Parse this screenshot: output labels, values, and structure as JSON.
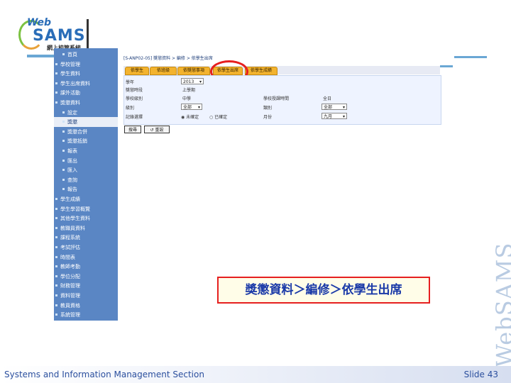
{
  "logo": {
    "web": "Web",
    "sams": "SAMS",
    "subtitle": "網上校管系統"
  },
  "sidebar": {
    "items": [
      {
        "label": "首頁",
        "level": "sub"
      },
      {
        "label": "學校管理",
        "level": "top"
      },
      {
        "label": "學生資料",
        "level": "top"
      },
      {
        "label": "學生出席資料",
        "level": "top"
      },
      {
        "label": "課外活動",
        "level": "top"
      },
      {
        "label": "獎懲資料",
        "level": "top"
      },
      {
        "label": "設定",
        "level": "sub"
      },
      {
        "label": "獎懲",
        "level": "sub",
        "active": true
      },
      {
        "label": "獎懲合併",
        "level": "sub"
      },
      {
        "label": "獎懲抵銷",
        "level": "sub"
      },
      {
        "label": "報表",
        "level": "sub"
      },
      {
        "label": "匯出",
        "level": "sub"
      },
      {
        "label": "匯入",
        "level": "sub"
      },
      {
        "label": "查詢",
        "level": "sub"
      },
      {
        "label": "報告",
        "level": "sub"
      },
      {
        "label": "學生成績",
        "level": "top"
      },
      {
        "label": "學生學習概覽",
        "level": "top"
      },
      {
        "label": "其他學生資料",
        "level": "top"
      },
      {
        "label": "教職員資料",
        "level": "top"
      },
      {
        "label": "課程系統",
        "level": "top"
      },
      {
        "label": "考試評估",
        "level": "top"
      },
      {
        "label": "時間表",
        "level": "top"
      },
      {
        "label": "教師考勤",
        "level": "top"
      },
      {
        "label": "學位分配",
        "level": "top"
      },
      {
        "label": "財務管理",
        "level": "top"
      },
      {
        "label": "資料管理",
        "level": "top"
      },
      {
        "label": "教員資格",
        "level": "top"
      },
      {
        "label": "系統管理",
        "level": "top"
      }
    ]
  },
  "breadcrumb": "[S-ANP02-05] 獎懲資料 > 編修 > 依學生出席",
  "tabs": [
    {
      "label": "依學生"
    },
    {
      "label": "依班級"
    },
    {
      "label": "依獎懲事項"
    },
    {
      "label": "依學生出席"
    },
    {
      "label": "依學生成績"
    }
  ],
  "form": {
    "year_label": "學年",
    "year_value": "2013",
    "period_label": "獎懲時段",
    "period_value": "上學期",
    "level_label": "學校級別",
    "level_value": "中學",
    "session_label": "學校授課時間",
    "session_value": "全日",
    "class_label": "級別",
    "class_value": "全部",
    "category_label": "類別",
    "category_value": "全部",
    "status_label": "記錄選擇",
    "radio1": "未確定",
    "radio2": "已確定",
    "month_label": "月份",
    "month_value": "九月"
  },
  "buttons": {
    "search": "搜尋",
    "reset": "重設"
  },
  "caption": "獎懲資料＞編修＞依學生出席",
  "watermark": "WebSAMS",
  "footer": {
    "left": "Systems and Information Management Section",
    "right": "Slide 43"
  }
}
